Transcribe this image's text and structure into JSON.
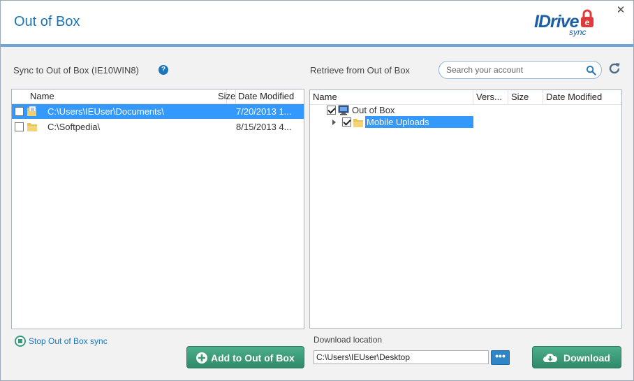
{
  "window": {
    "title": "Out of Box",
    "close_glyph": "✕",
    "logo": {
      "main": "IDrive",
      "sub": "sync"
    }
  },
  "left": {
    "label": "Sync to Out of Box  (IE10WIN8)",
    "help_glyph": "?",
    "columns": {
      "name": "Name",
      "size": "Size",
      "date": "Date Modified"
    },
    "rows": [
      {
        "checked": false,
        "selected": true,
        "name": "C:\\Users\\IEUser\\Documents\\",
        "size": "",
        "date": "7/20/2013 1..."
      },
      {
        "checked": false,
        "selected": false,
        "name": "C:\\Softpedia\\",
        "size": "",
        "date": "8/15/2013 4..."
      }
    ]
  },
  "right": {
    "label": "Retrieve from Out of Box",
    "search": {
      "placeholder": "Search your account",
      "value": ""
    },
    "columns": {
      "name": "Name",
      "version": "Vers...",
      "size": "Size",
      "date": "Date Modified"
    },
    "tree": {
      "root": {
        "label": "Out of Box",
        "checked": true
      },
      "child": {
        "label": "Mobile Uploads",
        "checked": true,
        "selected": true
      }
    }
  },
  "footer": {
    "stop_sync": "Stop Out of Box sync",
    "add_button": "Add to Out of Box",
    "download_location_label": "Download location",
    "download_location_value": "C:\\Users\\IEUser\\Desktop",
    "browse_glyph": "•••",
    "download_button": "Download"
  },
  "colors": {
    "accent": "#1b75bb",
    "selection": "#3399ff",
    "button_green": "#3a9b7a"
  },
  "icons": [
    "close-icon",
    "help-icon",
    "search-icon",
    "refresh-icon",
    "folder-icon",
    "computer-icon",
    "stop-icon",
    "plus-icon",
    "cloud-download-icon"
  ]
}
